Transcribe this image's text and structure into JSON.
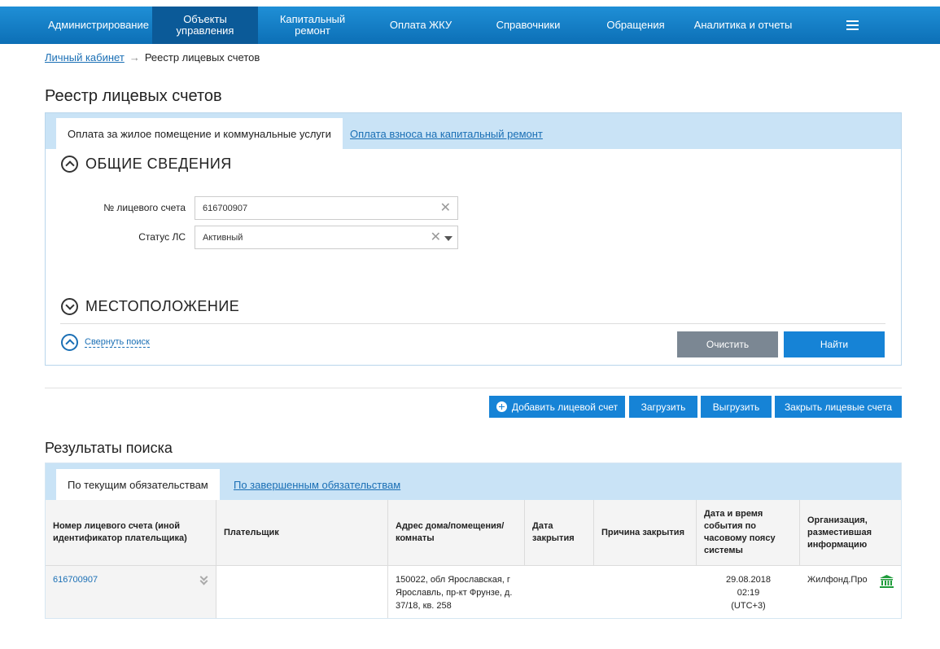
{
  "nav": {
    "items": [
      {
        "label": "Администрирование",
        "active": false
      },
      {
        "label": "Объекты управления",
        "active": true
      },
      {
        "label": "Капитальный ремонт",
        "active": false
      },
      {
        "label": "Оплата ЖКУ",
        "active": false
      },
      {
        "label": "Справочники",
        "active": false
      },
      {
        "label": "Обращения",
        "active": false
      },
      {
        "label": "Аналитика и отчеты",
        "active": false
      }
    ],
    "menu_icon": "hamburger-icon"
  },
  "breadcrumb": {
    "home": "Личный кабинет",
    "separator": "→",
    "current": "Реестр лицевых счетов"
  },
  "page_title": "Реестр лицевых счетов",
  "search": {
    "tabs": [
      {
        "label": "Оплата за жилое помещение и коммунальные услуги",
        "active": true
      },
      {
        "label": "Оплата взноса на капитальный ремонт",
        "active": false
      }
    ],
    "general_section": "ОБЩИЕ СВЕДЕНИЯ",
    "account_label": "№ лицевого счета",
    "account_value": "616700907",
    "status_label": "Статус ЛС",
    "status_value": "Активный",
    "location_section": "МЕСТОПОЛОЖЕНИЕ",
    "collapse_label": "Свернуть поиск",
    "clear_label": "Очистить",
    "find_label": "Найти"
  },
  "actions": {
    "add": "Добавить лицевой счет",
    "upload": "Загрузить",
    "export": "Выгрузить",
    "close": "Закрыть лицевые счета"
  },
  "results": {
    "title": "Результаты поиска",
    "tabs": [
      {
        "label": "По текущим обязательствам",
        "active": true
      },
      {
        "label": "По завершенным обязательствам",
        "active": false
      }
    ],
    "columns": [
      "Номер лицевого счета (иной идентификатор плательщика)",
      "Плательщик",
      "Адрес дома/помещения/комнаты",
      "Дата закрытия",
      "Причина закрытия",
      "Дата и время события по часовому поясу системы",
      "Организация, разместившая информацию"
    ],
    "rows": [
      {
        "account": "616700907",
        "payer": "",
        "address": "150022, обл Ярославская, г Ярославль, пр-кт Фрунзе, д. 37/18, кв. 258",
        "close_date": "",
        "close_reason": "",
        "event_date": "29.08.2018",
        "event_time": "02:19",
        "event_tz": "(UTC+3)",
        "organization": "Жилфонд.Про"
      }
    ]
  },
  "colors": {
    "nav": "#1683d6",
    "nav_active": "#0b5a98",
    "tabbar": "#c9e3f6",
    "link": "#1a6fb5",
    "button_grey": "#7b8793",
    "bank_icon": "#1e9b3a"
  }
}
